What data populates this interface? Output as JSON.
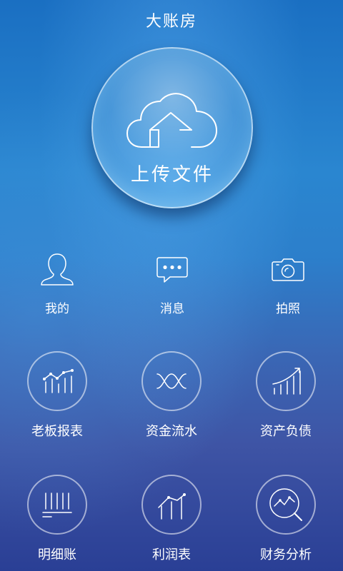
{
  "header": {
    "title": "大账房"
  },
  "upload": {
    "label": "上传文件",
    "icon": "cloud-upload-icon"
  },
  "quick": [
    {
      "label": "我的",
      "icon": "user-icon"
    },
    {
      "label": "消息",
      "icon": "message-icon"
    },
    {
      "label": "拍照",
      "icon": "camera-icon"
    }
  ],
  "grid": [
    {
      "label": "老板报表",
      "icon": "line-bar-chart-icon"
    },
    {
      "label": "资金流水",
      "icon": "wave-flow-icon"
    },
    {
      "label": "资产负债",
      "icon": "growth-chart-icon"
    },
    {
      "label": "明细账",
      "icon": "ledger-lines-icon"
    },
    {
      "label": "利润表",
      "icon": "profit-chart-icon"
    },
    {
      "label": "财务分析",
      "icon": "magnifier-chart-icon"
    }
  ],
  "colors": {
    "background_top": "#1a6fc2",
    "background_bottom": "#2a3f95",
    "text": "#ffffff"
  }
}
